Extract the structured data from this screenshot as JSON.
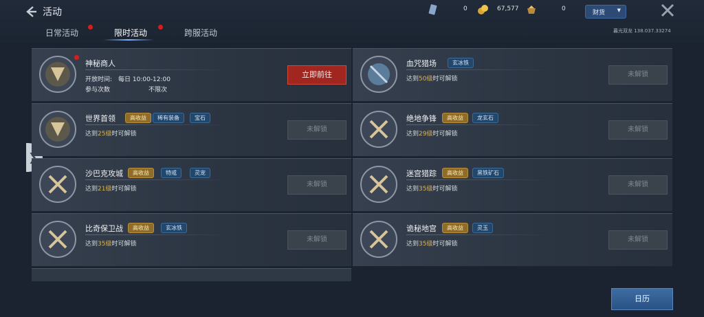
{
  "header": {
    "title": "活动",
    "resources": [
      {
        "icon": "ticket-icon",
        "value": "0"
      },
      {
        "icon": "gold-coin-icon",
        "value": "67,577"
      },
      {
        "icon": "treasure-icon",
        "value": "0"
      }
    ],
    "currency_label": "财货",
    "server_info": "暮光双龙  138.037.33274"
  },
  "tabs": [
    {
      "label": "日常活动",
      "active": false,
      "dot": true
    },
    {
      "label": "限时活动",
      "active": true,
      "dot": true
    },
    {
      "label": "跨服活动",
      "active": false,
      "dot": false
    }
  ],
  "cards": [
    {
      "name": "神秘商人",
      "open_label": "开放时间:",
      "open_value": "每日 10:00-12:00",
      "count_label": "参与次数",
      "count_value": "不限次",
      "button": "立即前往",
      "tags": []
    },
    {
      "name": "血咒猎场",
      "req_pre": "达到",
      "req_lv": "50级",
      "req_post": "时可解锁",
      "button": "未解锁",
      "tags": [
        {
          "label": "玄冰铁",
          "style": "blue"
        }
      ]
    },
    {
      "name": "世界首领",
      "req_pre": "达到",
      "req_lv": "25级",
      "req_post": "时可解锁",
      "button": "未解锁",
      "tags": [
        {
          "label": "高收益",
          "style": "gold"
        },
        {
          "label": "稀有装备",
          "style": "blue"
        },
        {
          "label": "宝石",
          "style": "blue"
        }
      ]
    },
    {
      "name": "绝地争锋",
      "req_pre": "达到",
      "req_lv": "29级",
      "req_post": "时可解锁",
      "button": "未解锁",
      "tags": [
        {
          "label": "高收益",
          "style": "gold"
        },
        {
          "label": "龙玄石",
          "style": "blue"
        }
      ]
    },
    {
      "name": "沙巴克攻城",
      "req_pre": "达到",
      "req_lv": "21级",
      "req_post": "时可解锁",
      "button": "未解锁",
      "tags": [
        {
          "label": "高收益",
          "style": "gold"
        },
        {
          "label": "特戒",
          "style": "blue"
        },
        {
          "label": "灵宠",
          "style": "blue"
        }
      ]
    },
    {
      "name": "迷宫猎踪",
      "req_pre": "达到",
      "req_lv": "35级",
      "req_post": "时可解锁",
      "button": "未解锁",
      "tags": [
        {
          "label": "高收益",
          "style": "gold"
        },
        {
          "label": "黑铁矿石",
          "style": "blue"
        }
      ]
    },
    {
      "name": "比奇保卫战",
      "req_pre": "达到",
      "req_lv": "35级",
      "req_post": "时可解锁",
      "button": "未解锁",
      "tags": [
        {
          "label": "高收益",
          "style": "gold"
        },
        {
          "label": "玄冰铁",
          "style": "blue"
        }
      ]
    },
    {
      "name": "诡秘地宫",
      "req_pre": "达到",
      "req_lv": "35级",
      "req_post": "时可解锁",
      "button": "未解锁",
      "tags": [
        {
          "label": "高收益",
          "style": "gold"
        },
        {
          "label": "灵玉",
          "style": "blue"
        }
      ]
    }
  ],
  "calendar_label": "日历"
}
